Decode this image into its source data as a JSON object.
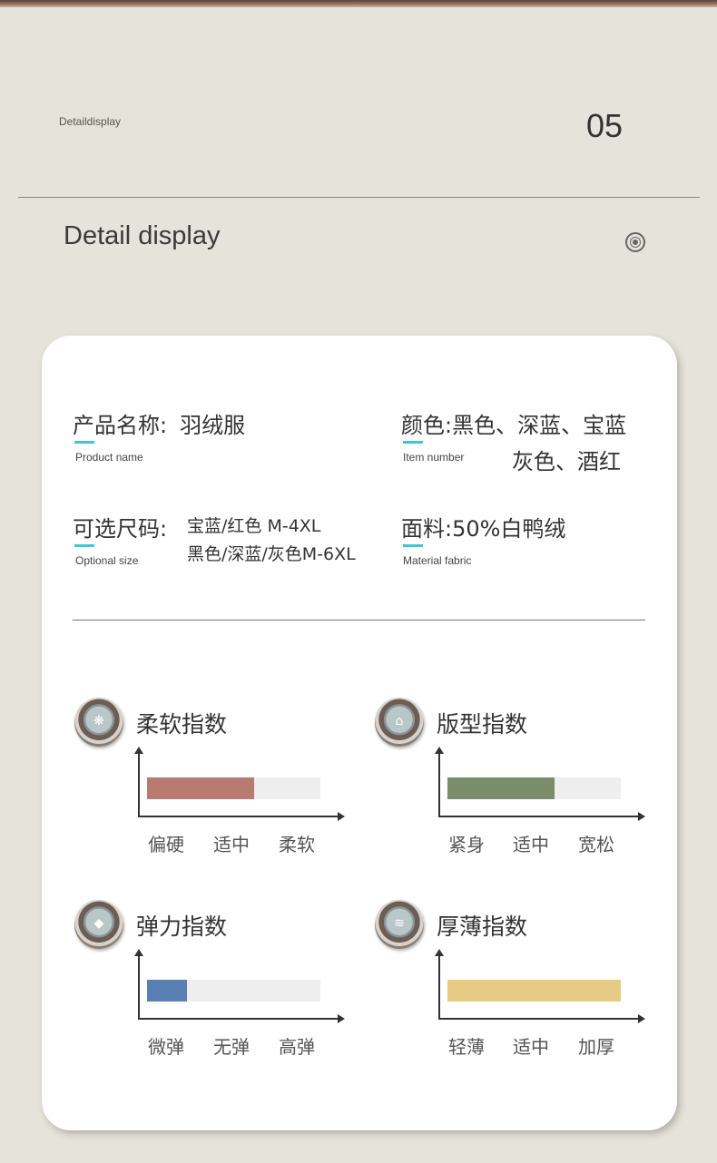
{
  "header": {
    "small_label": "Detaildisplay",
    "page_number": "05"
  },
  "section": {
    "title": "Detail display",
    "icon": "target-icon"
  },
  "product": {
    "name_label": "产品名称:",
    "name_value": "羽绒服",
    "name_en": "Product name",
    "color_label": "颜色:",
    "color_value_1": "黑色、深蓝、宝蓝",
    "color_value_2": "灰色、酒红",
    "color_en": "Item number",
    "size_label": "可选尺码:",
    "size_value_1": "宝蓝/红色 M-4XL",
    "size_value_2": "黑色/深蓝/灰色M-6XL",
    "size_en": "Optional size",
    "fabric_label": "面料:",
    "fabric_value": "50%白鸭绒",
    "fabric_en": "Material fabric"
  },
  "gauges": [
    {
      "title": "柔软指数",
      "icon": "feather-icon",
      "fill": 0.62,
      "color": "#b97a72",
      "labels": [
        "偏硬",
        "适中",
        "柔软"
      ]
    },
    {
      "title": "版型指数",
      "icon": "tshirt-icon",
      "fill": 0.62,
      "color": "#7a8c69",
      "labels": [
        "紧身",
        "适中",
        "宽松"
      ]
    },
    {
      "title": "弹力指数",
      "icon": "elastic-icon",
      "fill": 0.23,
      "color": "#5a7fb5",
      "labels": [
        "微弹",
        "无弹",
        "高弹"
      ]
    },
    {
      "title": "厚薄指数",
      "icon": "layers-icon",
      "fill": 1.0,
      "color": "#e6cb85",
      "labels": [
        "轻薄",
        "适中",
        "加厚"
      ]
    }
  ]
}
